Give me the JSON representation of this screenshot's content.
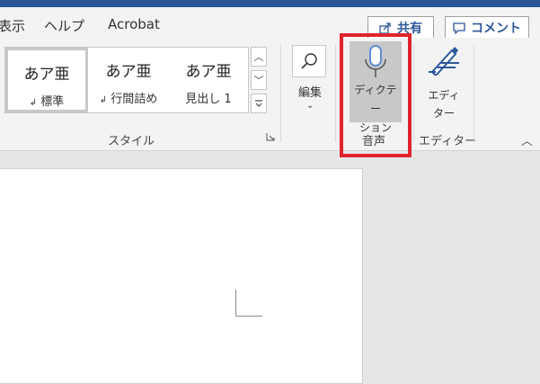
{
  "tabs": [
    "表示",
    "ヘルプ",
    "Acrobat"
  ],
  "header_buttons": {
    "share_label": "共有",
    "comment_label": "コメント"
  },
  "styles_group": {
    "items": [
      {
        "preview": "あア亜",
        "name": "標準",
        "marker": "↲"
      },
      {
        "preview": "あア亜",
        "name": "行間詰め",
        "marker": "↲"
      },
      {
        "preview": "あア亜",
        "name": "見出し 1",
        "marker": ""
      }
    ],
    "label": "スタイル"
  },
  "edit_group": {
    "label": "編集"
  },
  "voice_group": {
    "dictate_label": [
      "ディクテー",
      "ション"
    ],
    "label": "音声"
  },
  "editor_group": {
    "editor_label": [
      "エディ",
      "ター"
    ],
    "label": "エディター"
  },
  "colors": {
    "accent": "#2b579a",
    "highlight": "#e0242c",
    "mic": "#5b8fd4"
  }
}
